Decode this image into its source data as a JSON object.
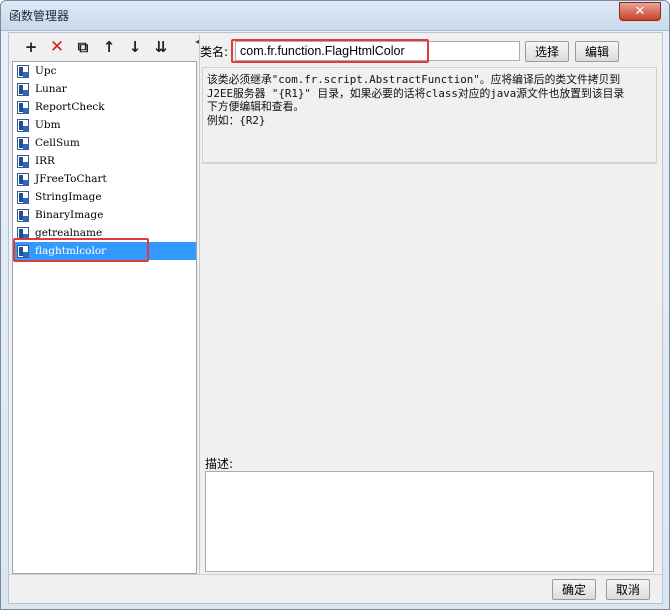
{
  "window": {
    "title": "函数管理器",
    "close_symbol": "✕"
  },
  "toolbar": {
    "buttons": [
      {
        "name": "add-icon",
        "glyph": "+"
      },
      {
        "name": "delete-icon",
        "glyph": "✕"
      },
      {
        "name": "copy-icon",
        "glyph": "⧉"
      },
      {
        "name": "move-up-icon",
        "glyph": "↑"
      },
      {
        "name": "move-down-icon",
        "glyph": "↓"
      },
      {
        "name": "sort-icon",
        "glyph": "⇊"
      }
    ],
    "collapse_glyph": "◂"
  },
  "function_list": {
    "items": [
      {
        "label": "Upc",
        "selected": false
      },
      {
        "label": "Lunar",
        "selected": false
      },
      {
        "label": "ReportCheck",
        "selected": false
      },
      {
        "label": "Ubm",
        "selected": false
      },
      {
        "label": "CellSum",
        "selected": false
      },
      {
        "label": "IRR",
        "selected": false
      },
      {
        "label": "JFreeToChart",
        "selected": false
      },
      {
        "label": "StringImage",
        "selected": false
      },
      {
        "label": "BinaryImage",
        "selected": false
      },
      {
        "label": "getrealname",
        "selected": false
      },
      {
        "label": "flaghtmlcolor",
        "selected": true
      }
    ]
  },
  "class_name": {
    "label": "类名:",
    "value": "com.fr.function.FlagHtmlColor",
    "select_button": "选择",
    "edit_button": "编辑"
  },
  "info": {
    "lines": [
      "该类必须继承\"com.fr.script.AbstractFunction\"。应将编译后的类文件拷贝到",
      "J2EE服务器 \"{R1}\" 目录，如果必要的话将class对应的java源文件也放置到该目录",
      "下方便编辑和查看。",
      "例如：{R2}"
    ]
  },
  "description": {
    "label": "描述:"
  },
  "footer": {
    "ok_button": "确定",
    "cancel_button": "取消"
  },
  "colors": {
    "selection": "#3399ff",
    "highlight_border": "#e03a3a",
    "close_button": "#c7412c"
  }
}
